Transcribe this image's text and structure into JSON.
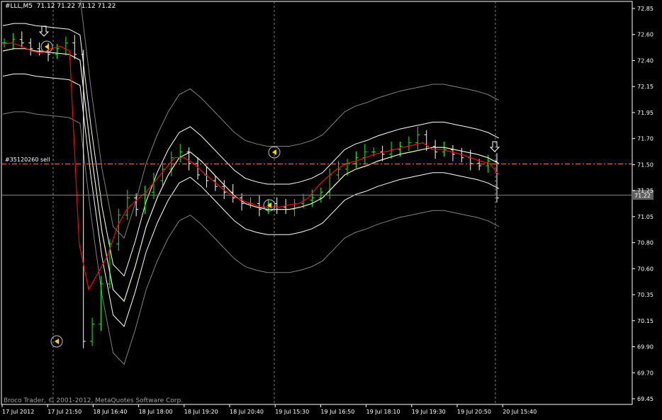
{
  "header": {
    "symbol": "#LLL,M5",
    "ohlc": "71.12 71.22 71.12 71.22"
  },
  "copyright": "Broco Trader, © 2001-2012, MetaQuotes Software Corp.",
  "order_label": "#35120260 sell",
  "current_price_label": "71.22",
  "colors": {
    "background": "#000000",
    "frame": "#ffffff",
    "bull": "#00ff00",
    "bear": "#ffffff",
    "ma_fast": "#ff0000",
    "ma_slow": "#f5f5c8",
    "envelope_inner": "#ffffff",
    "envelope_outer": "#808080",
    "order_line": "#ff6a00",
    "grid": "#808080",
    "marker": "#ffd700"
  },
  "chart_data": {
    "type": "candlestick",
    "title": "",
    "y_ticks": [
      "72.85",
      "72.60",
      "72.40",
      "72.15",
      "71.95",
      "71.70",
      "71.50",
      "71.25",
      "71.05",
      "70.80",
      "70.60",
      "70.35",
      "70.15",
      "69.90",
      "69.70",
      "69.45"
    ],
    "x_ticks": [
      "17 Jul 2012",
      "17 Jul 21:50",
      "18 Jul 16:40",
      "18 Jul 18:00",
      "18 Jul 19:20",
      "18 Jul 20:40",
      "19 Jul 15:30",
      "19 Jul 16:50",
      "19 Jul 18:10",
      "19 Jul 19:30",
      "19 Jul 20:50",
      "20 Jul 15:40"
    ],
    "ylim": [
      69.45,
      72.85
    ],
    "order_price": 71.5,
    "current_price": 71.22,
    "series": [
      {
        "name": "price",
        "values": [
          72.55,
          72.58,
          72.55,
          72.5,
          72.48,
          72.45,
          72.5,
          72.55,
          72.45,
          69.95,
          70.1,
          70.45,
          70.8,
          71.05,
          71.2,
          71.1,
          71.25,
          71.35,
          71.45,
          71.55,
          71.6,
          71.5,
          71.4,
          71.35,
          71.3,
          71.25,
          71.2,
          71.15,
          71.15,
          71.1,
          71.15,
          71.12,
          71.1,
          71.15,
          71.18,
          71.2,
          71.25,
          71.4,
          71.45,
          71.5,
          71.55,
          71.6,
          71.6,
          71.58,
          71.62,
          71.65,
          71.68,
          71.75,
          71.65,
          71.6,
          71.62,
          71.58,
          71.55,
          71.5,
          71.48,
          71.52,
          71.2
        ]
      },
      {
        "name": "ma_fast",
        "values": [
          72.54,
          72.55,
          72.52,
          72.48,
          72.46,
          72.5,
          72.52,
          72.48,
          70.8,
          70.4,
          70.55,
          70.7,
          70.95,
          71.1,
          71.18,
          71.25,
          71.35,
          71.45,
          71.55,
          71.55,
          71.5,
          71.42,
          71.35,
          71.28,
          71.22,
          71.18,
          71.15,
          71.12,
          71.12,
          71.12,
          71.14,
          71.15,
          71.2,
          71.3,
          71.38,
          71.45,
          71.5,
          71.52,
          71.55,
          71.58,
          71.6,
          71.62,
          71.64,
          71.66,
          71.68,
          71.62,
          71.62,
          71.6,
          71.58,
          71.55,
          71.52,
          71.5,
          71.4
        ]
      },
      {
        "name": "ma_slow",
        "values": [
          72.48,
          72.5,
          72.5,
          72.48,
          72.47,
          72.46,
          72.45,
          72.4,
          71.6,
          70.9,
          70.4,
          70.3,
          70.6,
          70.95,
          71.2,
          71.4,
          71.55,
          71.6,
          71.52,
          71.42,
          71.32,
          71.22,
          71.15,
          71.12,
          71.1,
          71.1,
          71.1,
          71.12,
          71.15,
          71.2,
          71.3,
          71.4,
          71.45,
          71.48,
          71.52,
          71.55,
          71.58,
          71.6,
          71.62,
          71.64,
          71.64,
          71.62,
          71.6,
          71.58,
          71.55,
          71.5
        ]
      }
    ]
  }
}
